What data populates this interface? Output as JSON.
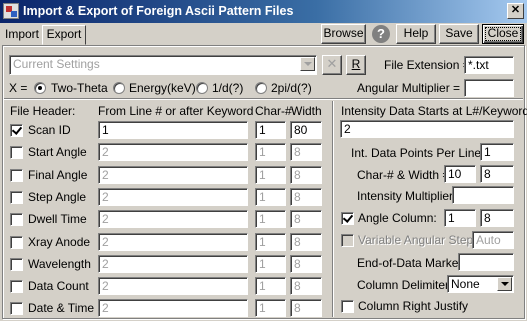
{
  "window": {
    "title": "Import & Export of Foreign Ascii Pattern Files",
    "close_glyph": "✕"
  },
  "tabs": [
    {
      "label": "Import"
    },
    {
      "label": "Export"
    }
  ],
  "toolbar": {
    "browse": "Browse",
    "help_glyph": "?",
    "help": "Help",
    "save": "Save",
    "close": "Close"
  },
  "settings": {
    "value": "Current Settings",
    "clear_glyph": "✕",
    "r_button": "R"
  },
  "file_extension": {
    "label": "File Extension =",
    "value": "*.txt"
  },
  "angular_multiplier": {
    "label": "Angular Multiplier =",
    "value": ""
  },
  "x_axis": {
    "label": "X =",
    "options": [
      {
        "label": "Two-Theta",
        "selected": true
      },
      {
        "label": "Energy(keV)",
        "selected": false
      },
      {
        "label": "1/d(?)",
        "selected": false
      },
      {
        "label": "2pi/d(?)",
        "selected": false
      }
    ]
  },
  "header_table": {
    "col_file_header": "File Header:",
    "col_from_line": "From Line # or after Keyword",
    "col_char": "Char-#",
    "col_width": "Width",
    "rows": [
      {
        "label": "Scan ID",
        "checked": true,
        "line": "1",
        "char": "1",
        "width": "80",
        "enabled": true
      },
      {
        "label": "Start Angle",
        "checked": false,
        "line": "2",
        "char": "1",
        "width": "8",
        "enabled": false
      },
      {
        "label": "Final Angle",
        "checked": false,
        "line": "2",
        "char": "1",
        "width": "8",
        "enabled": false
      },
      {
        "label": "Step Angle",
        "checked": false,
        "line": "2",
        "char": "1",
        "width": "8",
        "enabled": false
      },
      {
        "label": "Dwell Time",
        "checked": false,
        "line": "2",
        "char": "1",
        "width": "8",
        "enabled": false
      },
      {
        "label": "Xray Anode",
        "checked": false,
        "line": "2",
        "char": "1",
        "width": "8",
        "enabled": false
      },
      {
        "label": "Wavelength",
        "checked": false,
        "line": "2",
        "char": "1",
        "width": "8",
        "enabled": false
      },
      {
        "label": "Data Count",
        "checked": false,
        "line": "2",
        "char": "1",
        "width": "8",
        "enabled": false
      },
      {
        "label": "Date & Time",
        "checked": false,
        "line": "2",
        "char": "1",
        "width": "8",
        "enabled": false
      }
    ]
  },
  "intensity": {
    "start_label": "Intensity Data Starts at L#/Keyword:",
    "start_value": "2",
    "points_label": "Int. Data Points Per Line =",
    "points_value": "1",
    "charwidth_label": "Char-# & Width =",
    "char_value": "10",
    "width_value": "8",
    "multiplier_label": "Intensity Multiplier =",
    "multiplier_value": "",
    "angle_col_label": "Angle Column:",
    "angle_col_checked": true,
    "angle_col_char": "1",
    "angle_col_width": "8",
    "var_steps_label": "Variable Angular Steps:",
    "var_steps_value": "Auto",
    "eod_label": "End-of-Data Marker:",
    "eod_value": "",
    "delim_label": "Column Delimiter:",
    "delim_value": "None",
    "right_justify_label": "Column Right Justify",
    "right_justify_checked": false
  }
}
